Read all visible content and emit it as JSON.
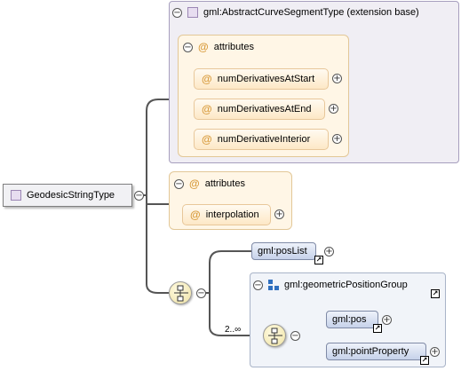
{
  "root": {
    "name": "GeodesicStringType"
  },
  "base_type": {
    "title": "gml:AbstractCurveSegmentType (extension base)",
    "attributes_label": "attributes",
    "attributes": [
      "numDerivativesAtStart",
      "numDerivativesAtEnd",
      "numDerivativeInterior"
    ]
  },
  "own_attributes": {
    "label": "attributes",
    "items": [
      "interpolation"
    ]
  },
  "choice": {
    "elements": [
      "gml:posList"
    ],
    "group": {
      "title": "gml:geometricPositionGroup",
      "cardinality": "2..∞",
      "elements": [
        "gml:pos",
        "gml:pointProperty"
      ]
    }
  },
  "symbols": {
    "collapse": "−",
    "expand": "+",
    "attribute": "@",
    "reference": "↗"
  },
  "colors": {
    "base_panel": "#f0eef4",
    "attribute_panel": "#fff6e6",
    "group_panel": "#f1f4f9",
    "element_box": "#c6d2ea",
    "attribute_box": "#fde8c6"
  }
}
